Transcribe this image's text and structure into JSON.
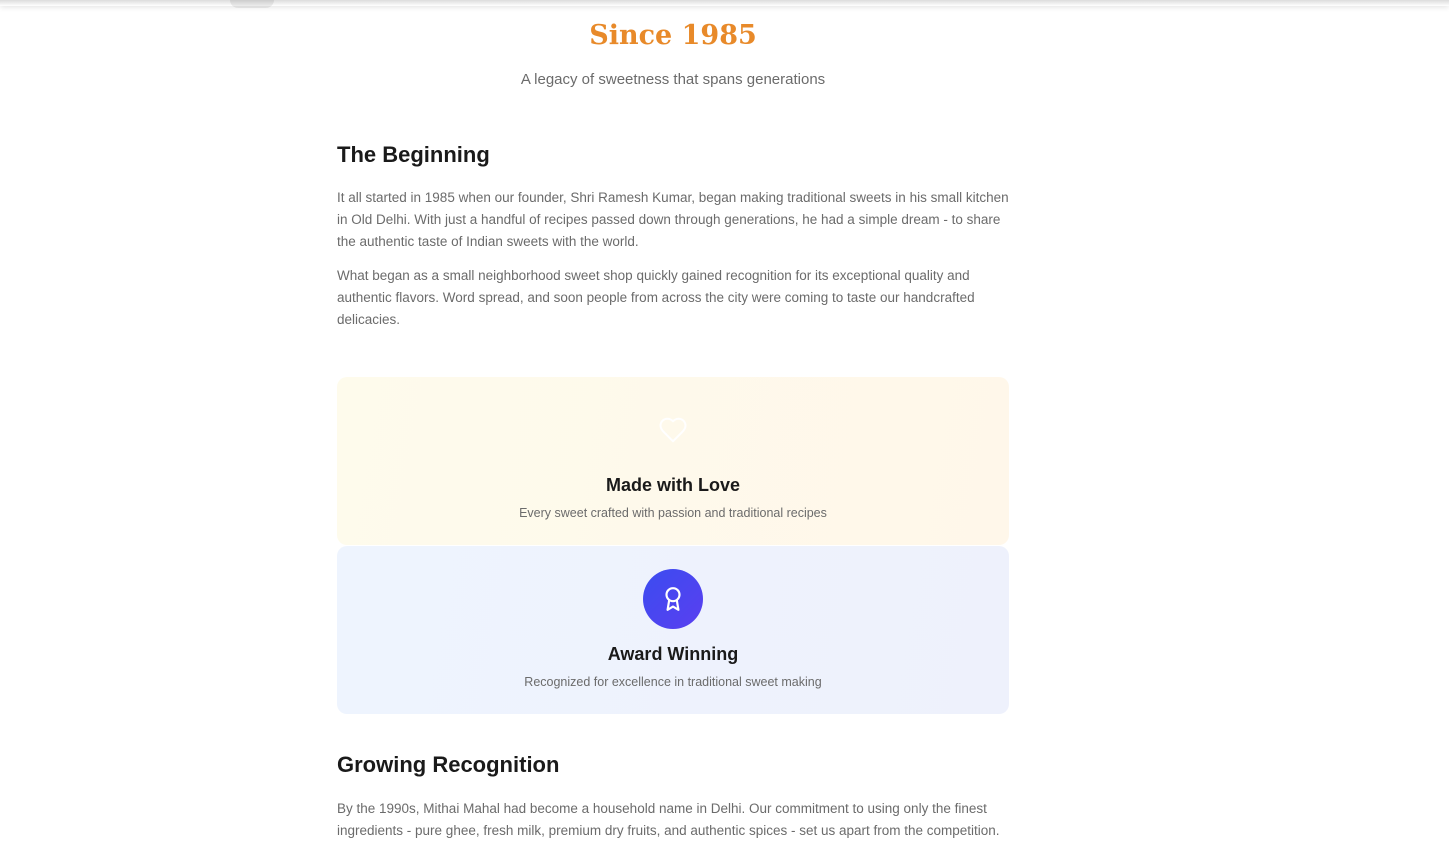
{
  "hero": {
    "title": "Since 1985",
    "subtitle": "A legacy of sweetness that spans generations",
    "title_color": "#e88a2a"
  },
  "beginning": {
    "heading": "The Beginning",
    "paragraphs": [
      "It all started in 1985 when our founder, Shri Ramesh Kumar, began making traditional sweets in his small kitchen in Old Delhi. With just a handful of recipes passed down through generations, he had a simple dream - to share the authentic taste of Indian sweets with the world.",
      "What began as a small neighborhood sweet shop quickly gained recognition for its exceptional quality and authentic flavors. Word spread, and soon people from across the city were coming to taste our handcrafted delicacies."
    ]
  },
  "features": [
    {
      "icon": "heart-icon",
      "title": "Made with Love",
      "description": "Every sweet crafted with passion and traditional recipes"
    },
    {
      "icon": "award-icon",
      "title": "Award Winning",
      "description": "Recognized for excellence in traditional sweet making",
      "accent": "#4447f0"
    }
  ],
  "growing": {
    "heading": "Growing Recognition",
    "paragraphs": [
      "By the 1990s, Mithai Mahal had become a household name in Delhi. Our commitment to using only the finest ingredients - pure ghee, fresh milk, premium dry fruits, and authentic spices - set us apart from the competition."
    ]
  }
}
